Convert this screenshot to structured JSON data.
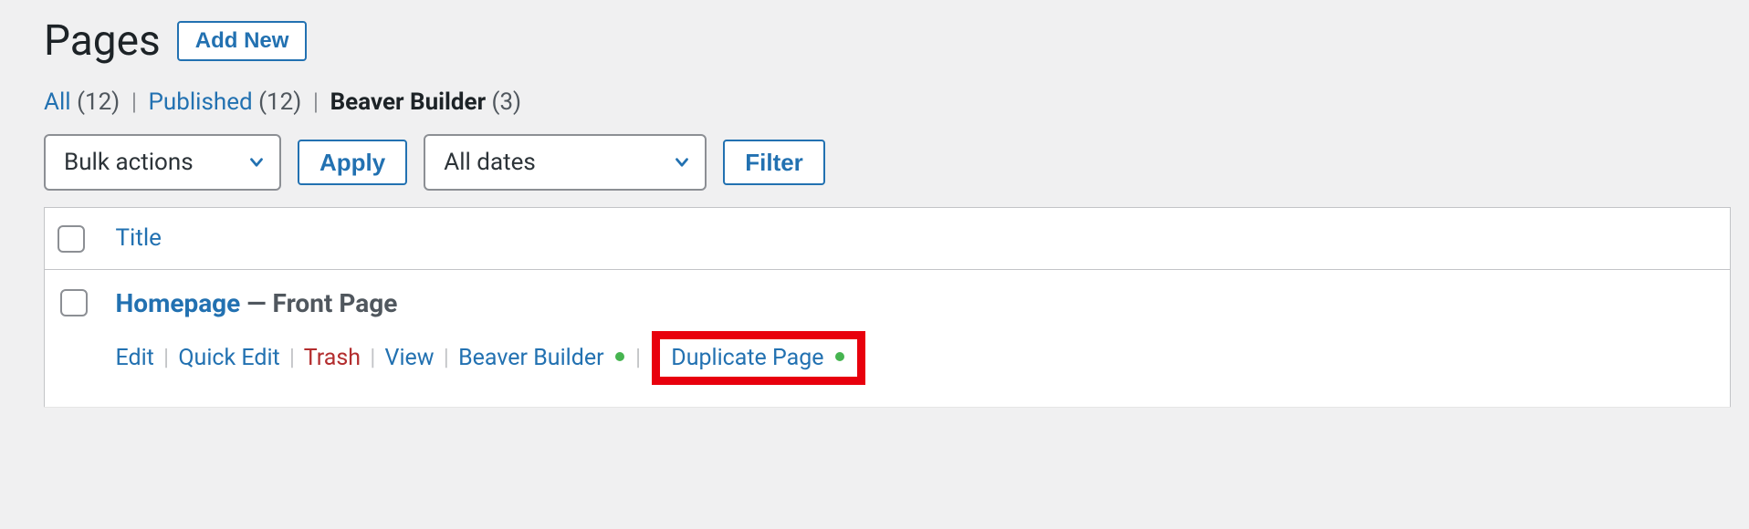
{
  "header": {
    "title": "Pages",
    "add_new_label": "Add New"
  },
  "filters": {
    "all": {
      "label": "All",
      "count": "(12)"
    },
    "published": {
      "label": "Published",
      "count": "(12)"
    },
    "beaver": {
      "label": "Beaver Builder",
      "count": "(3)"
    }
  },
  "tablenav": {
    "bulk_label": "Bulk actions",
    "apply_label": "Apply",
    "dates_label": "All dates",
    "filter_label": "Filter"
  },
  "table": {
    "col_title": "Title"
  },
  "row": {
    "title": "Homepage",
    "suffix": " — Front Page",
    "actions": {
      "edit": "Edit",
      "quick_edit": "Quick Edit",
      "trash": "Trash",
      "view": "View",
      "beaver": "Beaver Builder",
      "duplicate": "Duplicate Page"
    }
  }
}
